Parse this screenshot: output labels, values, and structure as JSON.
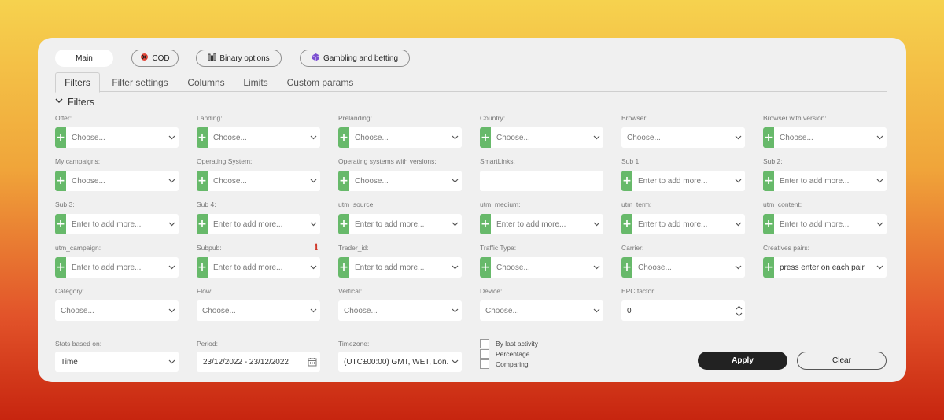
{
  "top_tabs": [
    {
      "label": "Main",
      "icon": "",
      "active": true
    },
    {
      "label": "COD",
      "icon": "cod-icon",
      "active": false
    },
    {
      "label": "Binary options",
      "icon": "chart-bars-icon",
      "active": false
    },
    {
      "label": "Gambling and betting",
      "icon": "dice-icon",
      "active": false
    }
  ],
  "tabs": [
    "Filters",
    "Filter settings",
    "Columns",
    "Limits",
    "Custom params"
  ],
  "section_title": "Filters",
  "fields": [
    {
      "label": "Offer:",
      "placeholder": "Choose...",
      "plus": true
    },
    {
      "label": "Landing:",
      "placeholder": "Choose...",
      "plus": true
    },
    {
      "label": "Prelanding:",
      "placeholder": "Choose...",
      "plus": true
    },
    {
      "label": "Country:",
      "placeholder": "Choose...",
      "plus": true
    },
    {
      "label": "Browser:",
      "placeholder": "Choose...",
      "plus": false
    },
    {
      "label": "Browser with version:",
      "placeholder": "Choose...",
      "plus": true
    },
    {
      "label": "My campaigns:",
      "placeholder": "Choose...",
      "plus": true
    },
    {
      "label": "Operating System:",
      "placeholder": "Choose...",
      "plus": true
    },
    {
      "label": "Operating systems with versions:",
      "placeholder": "Choose...",
      "plus": true
    },
    {
      "label": "SmartLinks:",
      "placeholder": "",
      "plus": false,
      "no_chevron": true
    },
    {
      "label": "Sub 1:",
      "placeholder": "Enter to add more...",
      "plus": true
    },
    {
      "label": "Sub 2:",
      "placeholder": "Enter to add more...",
      "plus": true
    },
    {
      "label": "Sub 3:",
      "placeholder": "Enter to add more...",
      "plus": true
    },
    {
      "label": "Sub 4:",
      "placeholder": "Enter to add more...",
      "plus": true
    },
    {
      "label": "utm_source:",
      "placeholder": "Enter to add more...",
      "plus": true
    },
    {
      "label": "utm_medium:",
      "placeholder": "Enter to add more...",
      "plus": true
    },
    {
      "label": "utm_term:",
      "placeholder": "Enter to add more...",
      "plus": true
    },
    {
      "label": "utm_content:",
      "placeholder": "Enter to add more...",
      "plus": true
    },
    {
      "label": "utm_campaign:",
      "placeholder": "Enter to add more...",
      "plus": true
    },
    {
      "label": "Subpub:",
      "placeholder": "Enter to add more...",
      "plus": true,
      "info": "i"
    },
    {
      "label": "Trader_id:",
      "placeholder": "Enter to add more...",
      "plus": true
    },
    {
      "label": "Traffic Type:",
      "placeholder": "Choose...",
      "plus": true
    },
    {
      "label": "Carrier:",
      "placeholder": "Choose...",
      "plus": true
    },
    {
      "label": "Creatives pairs:",
      "placeholder": "press enter on each pair",
      "plus": true,
      "dark": true
    },
    {
      "label": "Category:",
      "placeholder": "Choose...",
      "plus": false
    },
    {
      "label": "Flow:",
      "placeholder": "Choose...",
      "plus": false
    },
    {
      "label": "Vertical:",
      "placeholder": "Choose...",
      "plus": false
    },
    {
      "label": "Device:",
      "placeholder": "Choose...",
      "plus": false
    },
    {
      "label": "EPC factor:",
      "placeholder": "0",
      "plus": false,
      "spinner": true,
      "dark": true
    }
  ],
  "bottom": {
    "stats_label": "Stats based on:",
    "stats_value": "Time",
    "period_label": "Period:",
    "period_value": "23/12/2022 - 23/12/2022",
    "timezone_label": "Timezone:",
    "timezone_value": "(UTC±00:00) GMT, WET, Lon..."
  },
  "checkboxes": [
    "By last activity",
    "Percentage",
    "Comparing"
  ],
  "buttons": {
    "apply": "Apply",
    "clear": "Clear"
  },
  "colors": {
    "plus_green": "#67b96a",
    "apply_bg": "#222222",
    "info_red": "#d0392b"
  }
}
